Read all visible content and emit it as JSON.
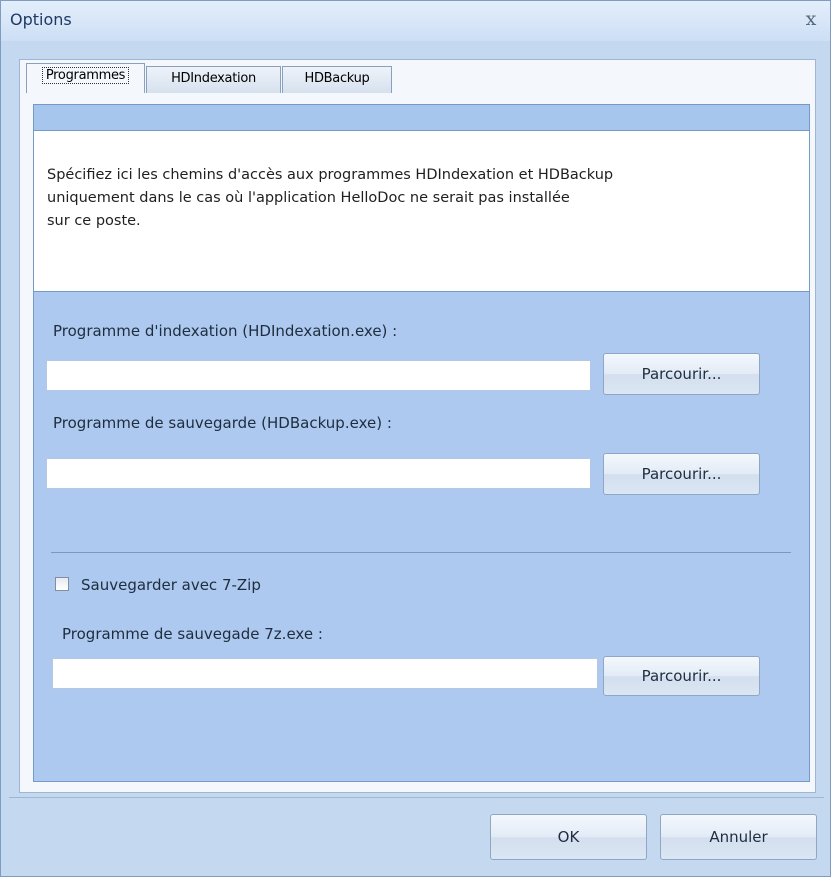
{
  "window": {
    "title": "Options",
    "close_glyph": "x"
  },
  "tabs": [
    {
      "label": "Programmes",
      "active": true
    },
    {
      "label": "HDIndexation",
      "active": false
    },
    {
      "label": "HDBackup",
      "active": false
    }
  ],
  "info_text": "Spécifiez ici les chemins d'accès aux programmes HDIndexation et HDBackup\nuniquement dans le cas où l'application HelloDoc ne serait pas installée\n sur ce poste.",
  "indexation": {
    "label": "Programme d'indexation (HDIndexation.exe) :",
    "value": "",
    "browse_label": "Parcourir..."
  },
  "backup": {
    "label": "Programme de sauvegarde (HDBackup.exe) :",
    "value": "",
    "browse_label": "Parcourir..."
  },
  "sevenzip": {
    "checkbox_label": "Sauvegarder avec 7-Zip",
    "checked": false,
    "label": "Programme de sauvegade 7z.exe :",
    "value": "",
    "browse_label": "Parcourir..."
  },
  "footer": {
    "ok_label": "OK",
    "cancel_label": "Annuler"
  }
}
